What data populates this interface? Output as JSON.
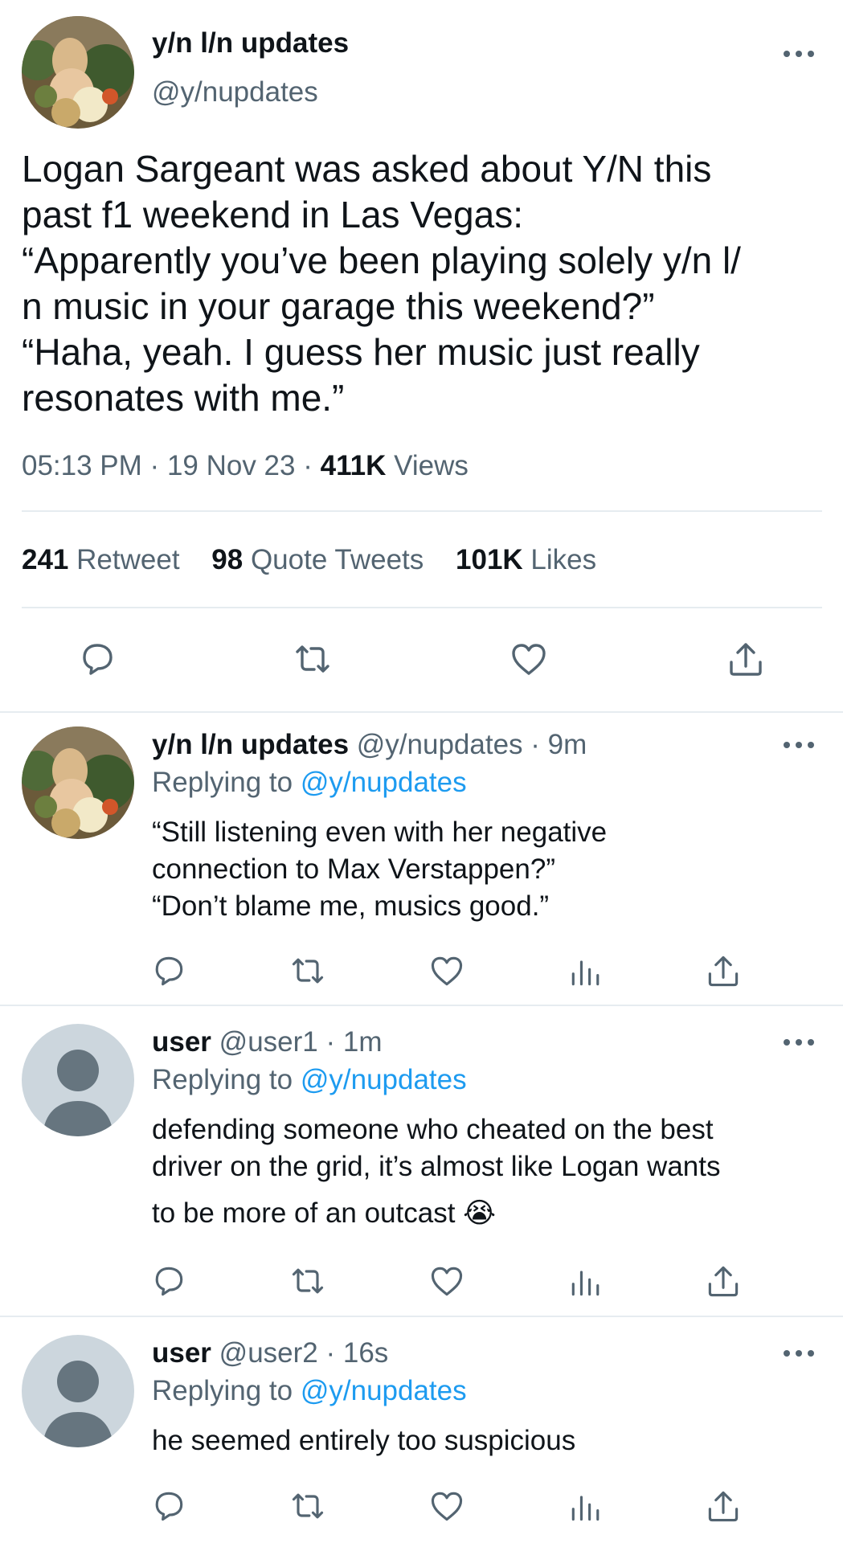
{
  "main_tweet": {
    "author_name": "y/n l/n updates",
    "handle": "@y/nupdates",
    "text_lines": [
      "Logan Sargeant was asked about Y/N this",
      "past f1 weekend in Las Vegas:",
      "“Apparently you’ve been playing solely y/n l/",
      "n music in your garage this weekend?”",
      "“Haha, yeah. I guess her music just really",
      "resonates with me.”"
    ],
    "time": "05:13 PM",
    "date": "19 Nov 23",
    "views_count": "411K",
    "views_label": "Views",
    "separator": "·",
    "retweets_count": "241",
    "retweets_label": "Retweet",
    "quotes_count": "98",
    "quotes_label": "Quote Tweets",
    "likes_count": "101K",
    "likes_label": "Likes"
  },
  "replies": [
    {
      "name": "y/n l/n updates",
      "handle": "@y/nupdates",
      "meta": "· 9m",
      "replying_prefix": "Replying to",
      "replying_handle": "@y/nupdates",
      "text_lines": [
        "“Still listening even with her negative",
        "connection to Max Verstappen?”",
        "“Don’t blame me, musics good.”"
      ]
    },
    {
      "name": "user",
      "handle": "@user1",
      "meta": "· 1m",
      "replying_prefix": "Replying to",
      "replying_handle": "@y/nupdates",
      "text_lines": [
        "defending someone who cheated on the best",
        "driver on the grid, it’s almost like Logan wants",
        "to be more of an outcast 😭"
      ]
    },
    {
      "name": "user",
      "handle": "@user2",
      "meta": "· 16s",
      "replying_prefix": "Replying to",
      "replying_handle": "@y/nupdates",
      "text_lines": [
        "he seemed entirely too suspicious"
      ]
    }
  ],
  "colors": {
    "text": "#0f1419",
    "muted": "#536471",
    "link": "#1d9bf0",
    "divider": "#e6ecf0",
    "default_avatar_bg": "#ccd6dd",
    "default_avatar_fg": "#66757f"
  },
  "icons": [
    "more-icon",
    "reply-icon",
    "retweet-icon",
    "like-icon",
    "views-icon",
    "share-icon"
  ]
}
